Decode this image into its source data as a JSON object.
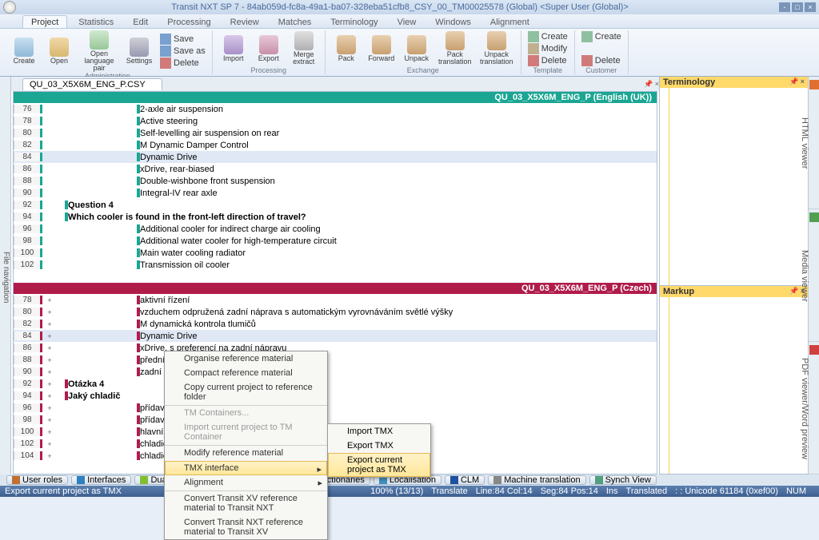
{
  "title": "Transit NXT SP 7 - 84ab059d-fc8a-49a1-ba07-328eba51cfb8_CSY_00_TM00025578 (Global) <Super User (Global)>",
  "ribbonTabs": [
    "Project",
    "Statistics",
    "Edit",
    "Processing",
    "Review",
    "Matches",
    "Terminology",
    "View",
    "Windows",
    "Alignment"
  ],
  "ribbon": {
    "admin": {
      "label": "Administration",
      "create": "Create",
      "open": "Open",
      "langpair": "Open\nlanguage pair",
      "settings": "Settings"
    },
    "file": {
      "save": "Save",
      "saveas": "Save as",
      "delete": "Delete"
    },
    "proc": {
      "label": "Processing",
      "import": "Import",
      "export": "Export",
      "merge": "Merge\nextract"
    },
    "exch": {
      "label": "Exchange",
      "pack": "Pack",
      "forward": "Forward",
      "unpack": "Unpack",
      "packtr": "Pack\ntranslation",
      "unpacktr": "Unpack\ntranslation"
    },
    "tmpl": {
      "label": "Template",
      "create": "Create",
      "modify": "Modify",
      "delete": "Delete"
    },
    "cust": {
      "label": "Customer",
      "create": "Create",
      "delete": "Delete"
    }
  },
  "fileTab": "QU_03_X5X6M_ENG_P.CSY",
  "srcHdr": "QU_03_X5X6M_ENG_P (English (UK))",
  "tgtHdr": "QU_03_X5X6M_ENG_P (Czech)",
  "srcRows": [
    {
      "n": "76",
      "t": "2-axle air suspension"
    },
    {
      "n": "78",
      "t": "Active steering"
    },
    {
      "n": "80",
      "t": "Self-levelling air suspension on rear"
    },
    {
      "n": "82",
      "t": "M Dynamic Damper Control"
    },
    {
      "n": "84",
      "t": "Dynamic Drive",
      "hl": true
    },
    {
      "n": "86",
      "t": "xDrive, rear-biased"
    },
    {
      "n": "88",
      "t": "Double-wishbone front suspension"
    },
    {
      "n": "90",
      "t": "Integral-IV rear axle"
    },
    {
      "n": "92",
      "t": "Question 4",
      "b": true
    },
    {
      "n": "94",
      "t": "Which cooler is found in the front-left direction of travel?",
      "b": true
    },
    {
      "n": "96",
      "t": "Additional cooler for indirect charge air cooling"
    },
    {
      "n": "98",
      "t": "Additional water cooler for high-temperature circuit"
    },
    {
      "n": "100",
      "t": "Main water cooling radiator"
    },
    {
      "n": "102",
      "t": "Transmission oil cooler"
    }
  ],
  "tgtRows": [
    {
      "n": "78",
      "t": "aktivní řízení"
    },
    {
      "n": "80",
      "t": "vzduchem odpružená zadní náprava s automatickým vyrovnáváním světlé výšky"
    },
    {
      "n": "82",
      "t": "M dynamická kontrola tlumičů"
    },
    {
      "n": "84",
      "t": "Dynamic Drive",
      "hl": true
    },
    {
      "n": "86",
      "t": "xDrive, s preferencí na zadní nápravu"
    },
    {
      "n": "88",
      "t": "přední n"
    },
    {
      "n": "90",
      "t": "zadní víc"
    },
    {
      "n": "92",
      "t": "Otázka 4",
      "b": true
    },
    {
      "n": "94",
      "t": "Jaký chladič",
      "b": true
    },
    {
      "n": "96",
      "t": "přídavný"
    },
    {
      "n": "98",
      "t": "přídavný"
    },
    {
      "n": "100",
      "t": "hlavní ch"
    },
    {
      "n": "102",
      "t": "chladič r"
    },
    {
      "n": "104",
      "t": "chladič r"
    }
  ],
  "ctx": {
    "organise": "Organise reference material",
    "compact": "Compact reference material",
    "copy": "Copy current project to reference folder",
    "tmcont": "TM Containers...",
    "importtm": "Import current project to TM Container",
    "modify": "Modify reference material",
    "tmx": "TMX interface",
    "align": "Alignment",
    "convxv": "Convert Transit XV reference material to Transit NXT",
    "convnxt": "Convert Transit NXT reference material to Transit XV"
  },
  "sub": {
    "imp": "Import TMX",
    "exp": "Export TMX",
    "expcur": "Export current project as TMX"
  },
  "term": "Terminology",
  "markup": "Markup",
  "sideLeft": "File navigation",
  "sideRight": [
    "HTML viewer",
    "Media viewer",
    "PDF viewer/Word preview"
  ],
  "bottomBtns": [
    "User roles",
    "Interfaces",
    "Dual Fuzzy",
    "Reference material",
    "Dictionaries",
    "Localisation",
    "CLM",
    "Machine translation",
    "Synch View"
  ],
  "status": {
    "hint": "Export current project as TMX",
    "pct": "100% (13/13)",
    "tr": "Translate",
    "line": "Line:84 Col:14",
    "seg": "Seg:84 Pos:14",
    "ins": "Ins",
    "trd": "Translated",
    "enc": ": : Unicode 61184 (0xef00)",
    "num": "NUM"
  }
}
